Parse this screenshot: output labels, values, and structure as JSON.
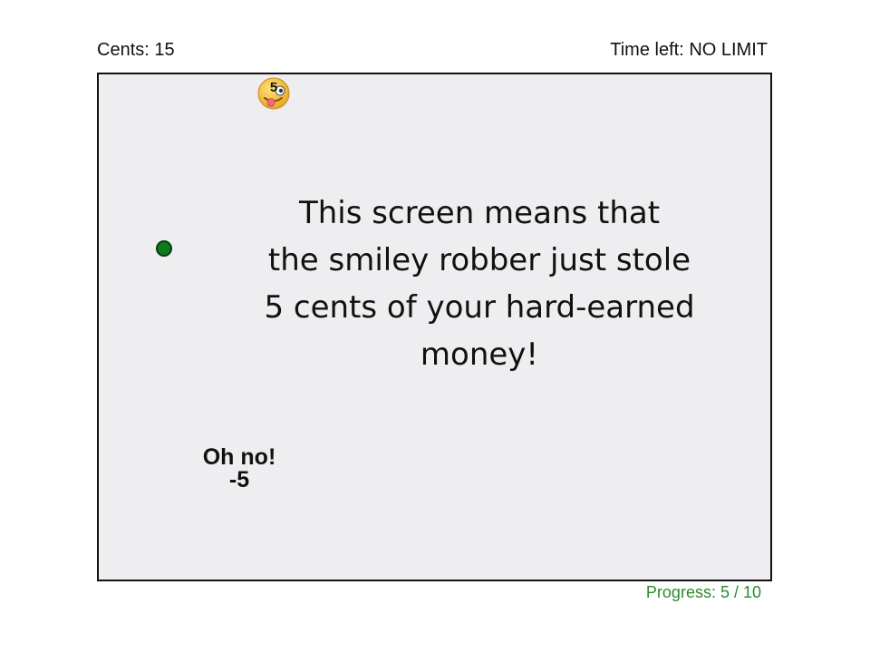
{
  "hud": {
    "cents_label": "Cents: 15",
    "time_label": "Time left: NO LIMIT",
    "progress_label": "Progress: 5 / 10"
  },
  "robber": {
    "icon": "smiley-robber-icon",
    "amount": "5"
  },
  "message": {
    "line1": "This screen means that",
    "line2": "the smiley robber just stole",
    "line3": "5 cents of your hard-earned",
    "line4": "money!"
  },
  "feedback": {
    "exclaim": "Oh no!",
    "delta": "-5"
  },
  "colors": {
    "arena_background": "#eeeef1",
    "player": "#0d7a1d",
    "progress_text": "#2b8a2b",
    "robber_face": "#f5c23b"
  }
}
